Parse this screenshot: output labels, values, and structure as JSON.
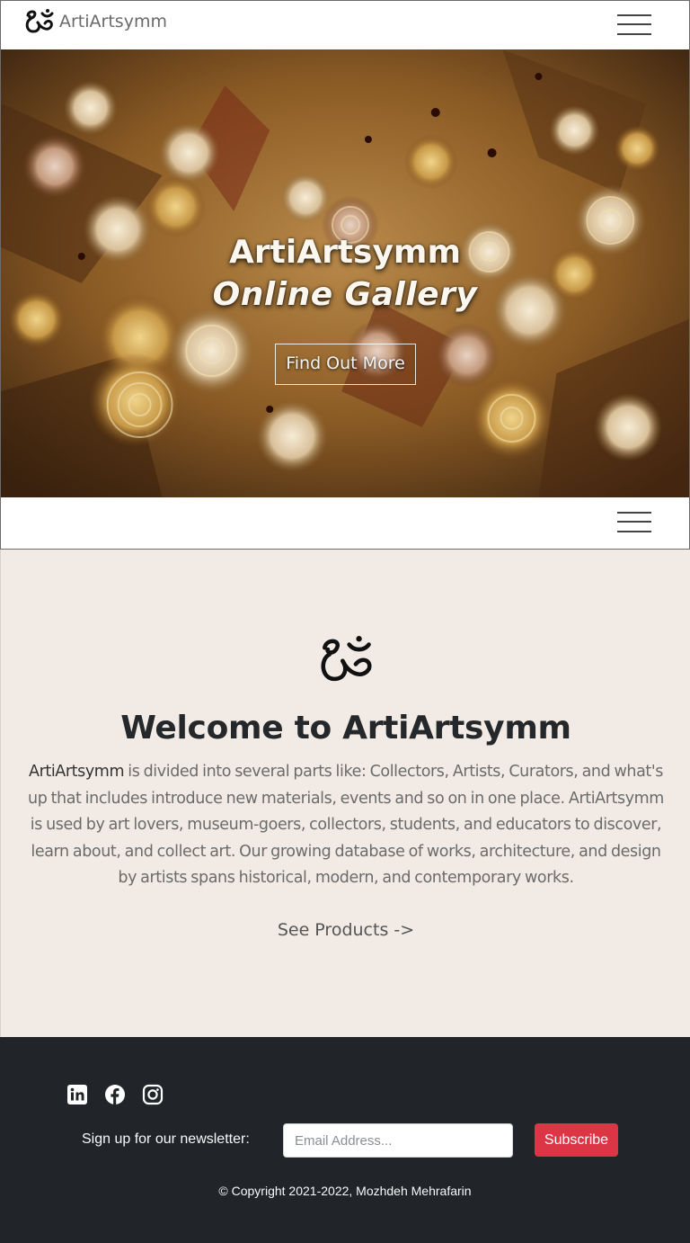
{
  "navbar": {
    "brand_name": "ArtiArtsymm",
    "brand_icon": "om-symbol-icon",
    "menu_icon": "hamburger-menu-icon"
  },
  "hero": {
    "title": "ArtiArtsymm",
    "subtitle": "Online Gallery",
    "button_label": "Find Out More"
  },
  "second_navbar": {
    "menu_icon": "hamburger-menu-icon"
  },
  "welcome": {
    "logo_icon": "om-symbol-icon",
    "title": "Welcome to ArtiArtsymm",
    "brand_word": "ArtiArtsymm",
    "body_text": " is divided into several parts like: Collectors, Artists, Curators, and what's up that includes introduce new materials, events and so on in one place. ArtiArtsymm is used by art lovers, museum-goers, collectors, students, and educators to discover, learn about, and collect art. Our growing database of works, architecture, and design by artists spans historical, modern, and contemporary works.",
    "link_label": "See Products ->"
  },
  "footer": {
    "social": [
      {
        "icon": "linkedin-icon"
      },
      {
        "icon": "facebook-icon"
      },
      {
        "icon": "instagram-icon"
      }
    ],
    "newsletter_label": "Sign up for our newsletter:",
    "email_placeholder": "Email Address...",
    "email_value": "",
    "subscribe_label": "Subscribe",
    "copyright": "© Copyright 2021-2022, Mozhdeh Mehrafarin"
  },
  "colors": {
    "welcome_bg": "#f2eae4",
    "footer_bg": "#212529",
    "subscribe_bg": "#dc3545"
  }
}
